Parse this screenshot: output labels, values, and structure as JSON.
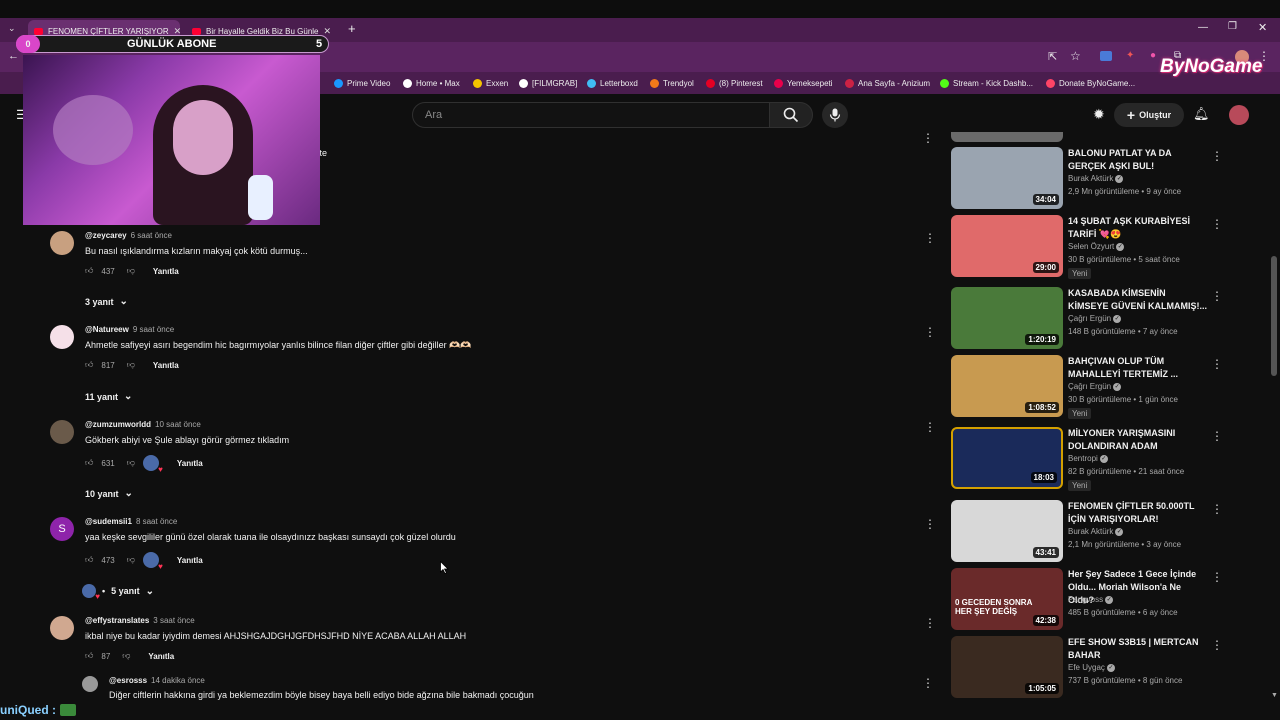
{
  "browser": {
    "tabs": [
      {
        "label": "FENOMEN ÇİFTLER YARIŞIYOR",
        "active": true
      },
      {
        "label": "Bir Hayalle Geldik Biz Bu Günle",
        "active": false
      }
    ],
    "bookmarks": [
      {
        "label": "Prime Video",
        "icon": "prime-icon",
        "color": "#1a98ff"
      },
      {
        "label": "Home • Max",
        "icon": "max-icon",
        "color": "#ffffff"
      },
      {
        "label": "Exxen",
        "icon": "exxen-icon",
        "color": "#f5c400"
      },
      {
        "label": "[FILMGRAB]",
        "icon": "filmgrab-icon",
        "color": "#ffffff"
      },
      {
        "label": "Letterboxd",
        "icon": "letterboxd-icon",
        "color": "#40bcf4"
      },
      {
        "label": "Trendyol",
        "icon": "trendyol-icon",
        "color": "#f27a1a"
      },
      {
        "label": "(8) Pinterest",
        "icon": "pinterest-icon",
        "color": "#e60023"
      },
      {
        "label": "Yemeksepeti",
        "icon": "yemeksepeti-icon",
        "color": "#ea004b"
      },
      {
        "label": "Ana Sayfa - Anizium",
        "icon": "anizium-icon",
        "color": "#cc2244"
      },
      {
        "label": "Stream - Kick Dashb...",
        "icon": "kick-icon",
        "color": "#53fc18"
      },
      {
        "label": "Donate ByNoGame...",
        "icon": "bynogame-icon",
        "color": "#ff4466"
      }
    ]
  },
  "overlay": {
    "sub_count_left": "0",
    "sub_label": "GÜNLÜK ABONE",
    "sub_count_right": "5",
    "logo": "ByNoGame",
    "chat_user": "uniQued :",
    "partial_text": "vite"
  },
  "header": {
    "search_placeholder": "Ara",
    "create_label": "Oluştur"
  },
  "comments": [
    {
      "author": "@zeycarey",
      "time": "6 saat önce",
      "text": "Bu nasıl ışıklandırma kızların makyaj çok kötü durmuş...",
      "likes": "437",
      "reply_label": "Yanıtla",
      "replies": "3 yanıt",
      "avatar_color": "#c8a080"
    },
    {
      "author": "@Natureew",
      "time": "9 saat önce",
      "text": "Ahmetle safiyeyi asırı begendim hic bagırmıyolar yanlıs bilince filan diğer çiftler gibi değiller 🫶🏻🫶🏻",
      "likes": "817",
      "reply_label": "Yanıtla",
      "replies": "11 yanıt",
      "avatar_color": "#f5e0e8"
    },
    {
      "author": "@zumzumworldd",
      "time": "10 saat önce",
      "text": "Gökberk abiyi ve Şule ablayı görür görmez tıkladım",
      "likes": "631",
      "reply_label": "Yanıtla",
      "replies": "10 yanıt",
      "avatar_color": "#6a5a4a"
    },
    {
      "author": "@sudemsii1",
      "time": "8 saat önce",
      "text": "yaa keşke sevgililer günü özel olarak tuana ile olsaydınızz başkası sunsaydı çok güzel olurdu",
      "likes": "473",
      "reply_label": "Yanıtla",
      "replies": "5 yanıt",
      "avatar_letter": "S",
      "avatar_color": "#8e24aa"
    },
    {
      "author": "@effystranslates",
      "time": "3 saat önce",
      "text": "ikbal niye bu kadar iyiydim demesi AHJSHGAJDGHJGFDHSJFHD NİYE ACABA ALLAH ALLAH",
      "likes": "87",
      "reply_label": "Yanıtla",
      "avatar_color": "#d0a890"
    },
    {
      "author": "@esrosss",
      "time": "14 dakika önce",
      "text": "Diğer ciftlerin hakkına girdi ya beklemezdim böyle bisey baya belli ediyo bide ağzına bile bakmadı çocuğun",
      "avatar_color": "#999999"
    }
  ],
  "videos": [
    {
      "title": "BALONU PATLAT YA DA GERÇEK AŞKI BUL!",
      "channel": "Burak Aktürk",
      "meta": "2,9 Mn görüntüleme • 9 ay önce",
      "duration": "34:04",
      "thumb_color": "#9aa4b0"
    },
    {
      "title": "14 ŞUBAT AŞK KURABİYESİ TARİFİ 💘😍",
      "channel": "Selen Özyurt",
      "meta": "30 B görüntüleme • 5 saat önce",
      "duration": "29:00",
      "badge": "Yeni",
      "thumb_color": "#e06a6a"
    },
    {
      "title": "KASABADA KİMSENİN KİMSEYE GÜVENİ KALMAMIŞ!...",
      "channel": "Çağrı Ergün",
      "meta": "148 B görüntüleme • 7 ay önce",
      "duration": "1:20:19",
      "thumb_color": "#4a7a3a"
    },
    {
      "title": "BAHÇIVAN OLUP TÜM MAHALLEYİ TERTEMİZ ...",
      "channel": "Çağrı Ergün",
      "meta": "30 B görüntüleme • 1 gün önce",
      "duration": "1:08:52",
      "badge": "Yeni",
      "thumb_color": "#c89a50"
    },
    {
      "title": "MİLYONER YARIŞMASINI DOLANDIRAN ADAM",
      "channel": "Bentropi",
      "meta": "82 B görüntüleme • 21 saat önce",
      "duration": "18:03",
      "badge": "Yeni",
      "thumb_color": "#1a2a5a"
    },
    {
      "title": "FENOMEN ÇİFTLER 50.000TL İÇİN YARIŞIYORLAR!",
      "channel": "Burak Aktürk",
      "meta": "2,1 Mn görüntüleme • 3 ay önce",
      "duration": "43:41",
      "thumb_color": "#d8d8d8"
    },
    {
      "title": "Her Şey Sadece 1 Gece İçinde Oldu... Moriah Wilson'a Ne Oldu?",
      "channel": "Pangvoss",
      "meta": "485 B görüntüleme • 6 ay önce",
      "duration": "42:38",
      "thumb_color": "#6a2a2a",
      "thumb_text": "0 GECEDEN SONRA HER ŞEY DEĞİŞ"
    },
    {
      "title": "EFE SHOW S3B15 | MERTCAN BAHAR",
      "channel": "Efe Uygaç",
      "meta": "737 B görüntüleme • 8 gün önce",
      "duration": "1:05:05",
      "thumb_color": "#3a2a20"
    }
  ]
}
